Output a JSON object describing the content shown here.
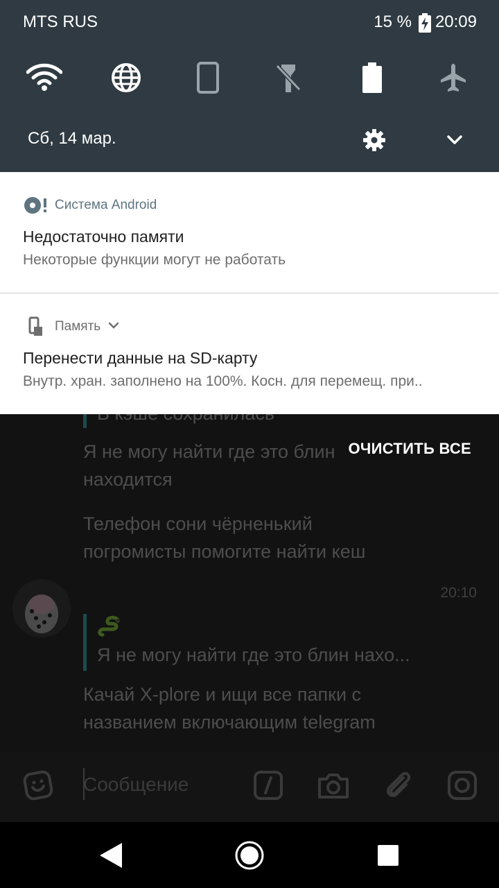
{
  "status_bar": {
    "carrier": "MTS RUS",
    "battery": "15 %",
    "time": "20:09"
  },
  "quick_settings": {
    "tiles": [
      "wifi-icon",
      "globe-icon",
      "phone-rotate-icon",
      "flashlight-off-icon",
      "battery-icon",
      "airplane-mode-off-icon"
    ],
    "date": "Сб, 14 мар."
  },
  "notifications": [
    {
      "app": "Система Android",
      "title": "Недостаточно памяти",
      "text": "Некоторые функции могут не работать"
    },
    {
      "app": "Память",
      "title": "Перенести данные на SD-карту",
      "text": "Внутр. хран. заполнено на 100%. Косн. для перемещ. при.."
    }
  ],
  "clear_all": "ОЧИСТИТЬ ВСЕ",
  "chat": {
    "partial_quote": "В кэше сохранилась",
    "msg1_line1": "Я не могу найти где это блин",
    "msg1_line2": "находится",
    "msg2_line1": "Телефон сони чёрненький",
    "msg2_line2": "погромисты помогите найти кеш",
    "time": "20:10",
    "reply_quote": "Я не могу найти где это блин нахо...",
    "msg3_line1": "Качай X-plore и ищи все папки с",
    "msg3_line2": "названием включающим telegram",
    "input_placeholder": "Сообщение"
  },
  "colors": {
    "shade": "#2f3a42",
    "accent_quote": "#1c4b4f"
  }
}
